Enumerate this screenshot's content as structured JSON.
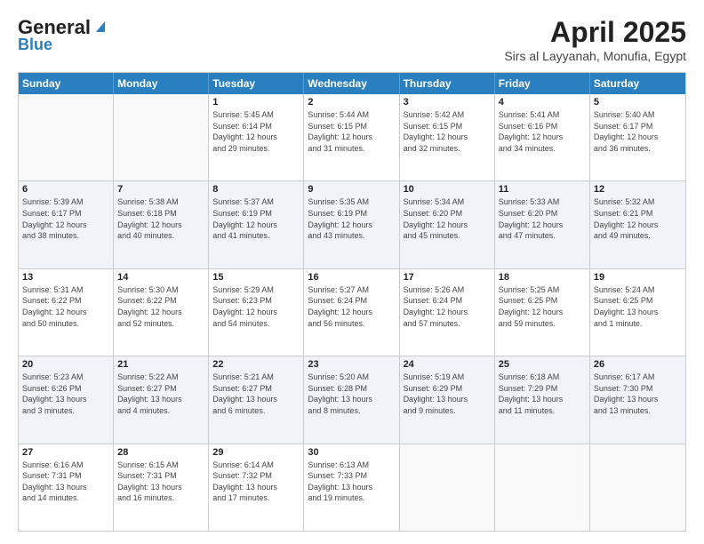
{
  "header": {
    "logo_general": "General",
    "logo_blue": "Blue",
    "month_title": "April 2025",
    "location": "Sirs al Layyanah, Monufia, Egypt"
  },
  "weekdays": [
    "Sunday",
    "Monday",
    "Tuesday",
    "Wednesday",
    "Thursday",
    "Friday",
    "Saturday"
  ],
  "rows": [
    [
      {
        "day": "",
        "empty": true
      },
      {
        "day": "",
        "empty": true
      },
      {
        "day": "1",
        "sunrise": "5:45 AM",
        "sunset": "6:14 PM",
        "daylight": "12 hours and 29 minutes."
      },
      {
        "day": "2",
        "sunrise": "5:44 AM",
        "sunset": "6:15 PM",
        "daylight": "12 hours and 31 minutes."
      },
      {
        "day": "3",
        "sunrise": "5:42 AM",
        "sunset": "6:15 PM",
        "daylight": "12 hours and 32 minutes."
      },
      {
        "day": "4",
        "sunrise": "5:41 AM",
        "sunset": "6:16 PM",
        "daylight": "12 hours and 34 minutes."
      },
      {
        "day": "5",
        "sunrise": "5:40 AM",
        "sunset": "6:17 PM",
        "daylight": "12 hours and 36 minutes."
      }
    ],
    [
      {
        "day": "6",
        "sunrise": "5:39 AM",
        "sunset": "6:17 PM",
        "daylight": "12 hours and 38 minutes."
      },
      {
        "day": "7",
        "sunrise": "5:38 AM",
        "sunset": "6:18 PM",
        "daylight": "12 hours and 40 minutes."
      },
      {
        "day": "8",
        "sunrise": "5:37 AM",
        "sunset": "6:19 PM",
        "daylight": "12 hours and 41 minutes."
      },
      {
        "day": "9",
        "sunrise": "5:35 AM",
        "sunset": "6:19 PM",
        "daylight": "12 hours and 43 minutes."
      },
      {
        "day": "10",
        "sunrise": "5:34 AM",
        "sunset": "6:20 PM",
        "daylight": "12 hours and 45 minutes."
      },
      {
        "day": "11",
        "sunrise": "5:33 AM",
        "sunset": "6:20 PM",
        "daylight": "12 hours and 47 minutes."
      },
      {
        "day": "12",
        "sunrise": "5:32 AM",
        "sunset": "6:21 PM",
        "daylight": "12 hours and 49 minutes."
      }
    ],
    [
      {
        "day": "13",
        "sunrise": "5:31 AM",
        "sunset": "6:22 PM",
        "daylight": "12 hours and 50 minutes."
      },
      {
        "day": "14",
        "sunrise": "5:30 AM",
        "sunset": "6:22 PM",
        "daylight": "12 hours and 52 minutes."
      },
      {
        "day": "15",
        "sunrise": "5:29 AM",
        "sunset": "6:23 PM",
        "daylight": "12 hours and 54 minutes."
      },
      {
        "day": "16",
        "sunrise": "5:27 AM",
        "sunset": "6:24 PM",
        "daylight": "12 hours and 56 minutes."
      },
      {
        "day": "17",
        "sunrise": "5:26 AM",
        "sunset": "6:24 PM",
        "daylight": "12 hours and 57 minutes."
      },
      {
        "day": "18",
        "sunrise": "5:25 AM",
        "sunset": "6:25 PM",
        "daylight": "12 hours and 59 minutes."
      },
      {
        "day": "19",
        "sunrise": "5:24 AM",
        "sunset": "6:25 PM",
        "daylight": "13 hours and 1 minute."
      }
    ],
    [
      {
        "day": "20",
        "sunrise": "5:23 AM",
        "sunset": "6:26 PM",
        "daylight": "13 hours and 3 minutes."
      },
      {
        "day": "21",
        "sunrise": "5:22 AM",
        "sunset": "6:27 PM",
        "daylight": "13 hours and 4 minutes."
      },
      {
        "day": "22",
        "sunrise": "5:21 AM",
        "sunset": "6:27 PM",
        "daylight": "13 hours and 6 minutes."
      },
      {
        "day": "23",
        "sunrise": "5:20 AM",
        "sunset": "6:28 PM",
        "daylight": "13 hours and 8 minutes."
      },
      {
        "day": "24",
        "sunrise": "5:19 AM",
        "sunset": "6:29 PM",
        "daylight": "13 hours and 9 minutes."
      },
      {
        "day": "25",
        "sunrise": "6:18 AM",
        "sunset": "7:29 PM",
        "daylight": "13 hours and 11 minutes."
      },
      {
        "day": "26",
        "sunrise": "6:17 AM",
        "sunset": "7:30 PM",
        "daylight": "13 hours and 13 minutes."
      }
    ],
    [
      {
        "day": "27",
        "sunrise": "6:16 AM",
        "sunset": "7:31 PM",
        "daylight": "13 hours and 14 minutes."
      },
      {
        "day": "28",
        "sunrise": "6:15 AM",
        "sunset": "7:31 PM",
        "daylight": "13 hours and 16 minutes."
      },
      {
        "day": "29",
        "sunrise": "6:14 AM",
        "sunset": "7:32 PM",
        "daylight": "13 hours and 17 minutes."
      },
      {
        "day": "30",
        "sunrise": "6:13 AM",
        "sunset": "7:33 PM",
        "daylight": "13 hours and 19 minutes."
      },
      {
        "day": "",
        "empty": true
      },
      {
        "day": "",
        "empty": true
      },
      {
        "day": "",
        "empty": true
      }
    ]
  ],
  "labels": {
    "sunrise_label": "Sunrise:",
    "sunset_label": "Sunset:",
    "daylight_label": "Daylight:"
  }
}
